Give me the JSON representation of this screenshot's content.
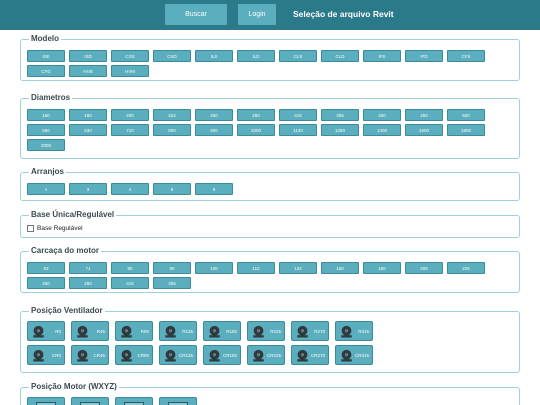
{
  "header": {
    "buscar_label": "Buscar",
    "login_label": "Login",
    "title": "Seleção de arquivo Revit"
  },
  "modelo": {
    "title": "Modelo",
    "items": [
      "ISE",
      "ISD",
      "CSS",
      "CSD",
      "ILS",
      "ILD",
      "CLS",
      "CLD",
      "IFS",
      "IFD",
      "CFS",
      "CFD",
      "HVB",
      "HVM"
    ]
  },
  "diametros": {
    "title": "Diametros",
    "items": [
      "160",
      "180",
      "200",
      "224",
      "250",
      "280",
      "315",
      "355",
      "400",
      "450",
      "500",
      "560",
      "630",
      "710",
      "800",
      "900",
      "1000",
      "1120",
      "1250",
      "1400",
      "1600",
      "1800",
      "2000"
    ]
  },
  "arranjos": {
    "title": "Arranjos",
    "items": [
      "1",
      "3",
      "4",
      "8",
      "9"
    ]
  },
  "base": {
    "title": "Base Única/Regulável",
    "checkbox_label": "Base Regulável",
    "checked": false
  },
  "carcaca": {
    "title": "Carcaça do motor",
    "items": [
      "63",
      "71",
      "80",
      "90",
      "100",
      "112",
      "132",
      "160",
      "180",
      "200",
      "225",
      "250",
      "280",
      "315",
      "355"
    ]
  },
  "ventilador": {
    "title": "Posição Ventilador",
    "items": [
      "R0",
      "R45",
      "R90",
      "R135",
      "R180",
      "R225",
      "R270",
      "R315",
      "CR0",
      "CR45",
      "CR90",
      "CR135",
      "CR180",
      "CR225",
      "CR270",
      "CR315"
    ]
  },
  "motor": {
    "title": "Posição Motor (WXYZ)",
    "count": 4
  }
}
